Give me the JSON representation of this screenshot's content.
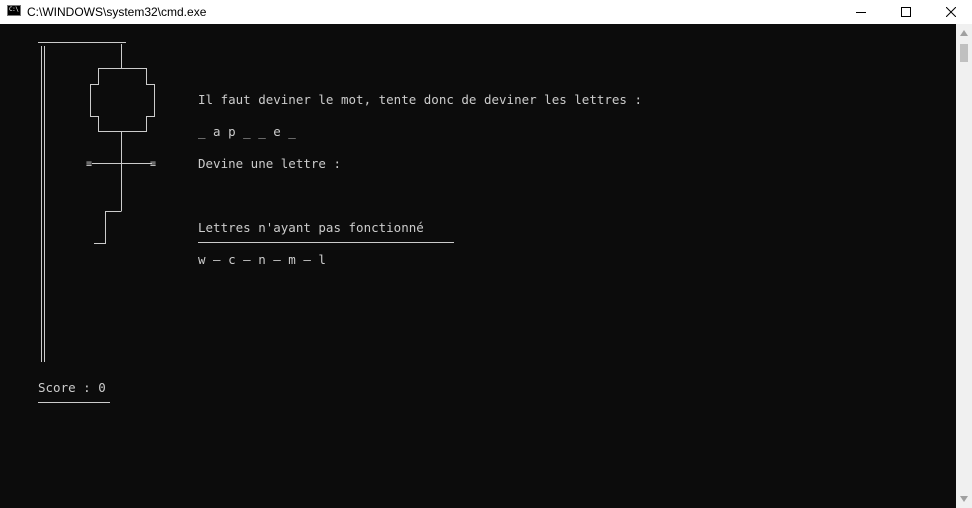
{
  "window": {
    "title": "C:\\WINDOWS\\system32\\cmd.exe",
    "icon_text": "C:\\"
  },
  "controls": {
    "minimize": "minimize-icon",
    "maximize": "maximize-icon",
    "close": "close-icon"
  },
  "game": {
    "intro": "Il faut deviner le mot, tente donc de deviner les lettres :",
    "masked_word": "_ a p _ _ e _",
    "prompt": "Devine une lettre :",
    "failed_header": "Lettres n'ayant pas fonctionné",
    "failed_letters": "w — c — n — m — l",
    "score_line": "Score : 0",
    "hanged_parts_drawn": [
      "gallows",
      "rope",
      "head",
      "body",
      "arms",
      "legs"
    ]
  },
  "colors": {
    "console_bg": "#0c0c0c",
    "console_text": "#cccccc",
    "titlebar_bg": "#ffffff"
  }
}
